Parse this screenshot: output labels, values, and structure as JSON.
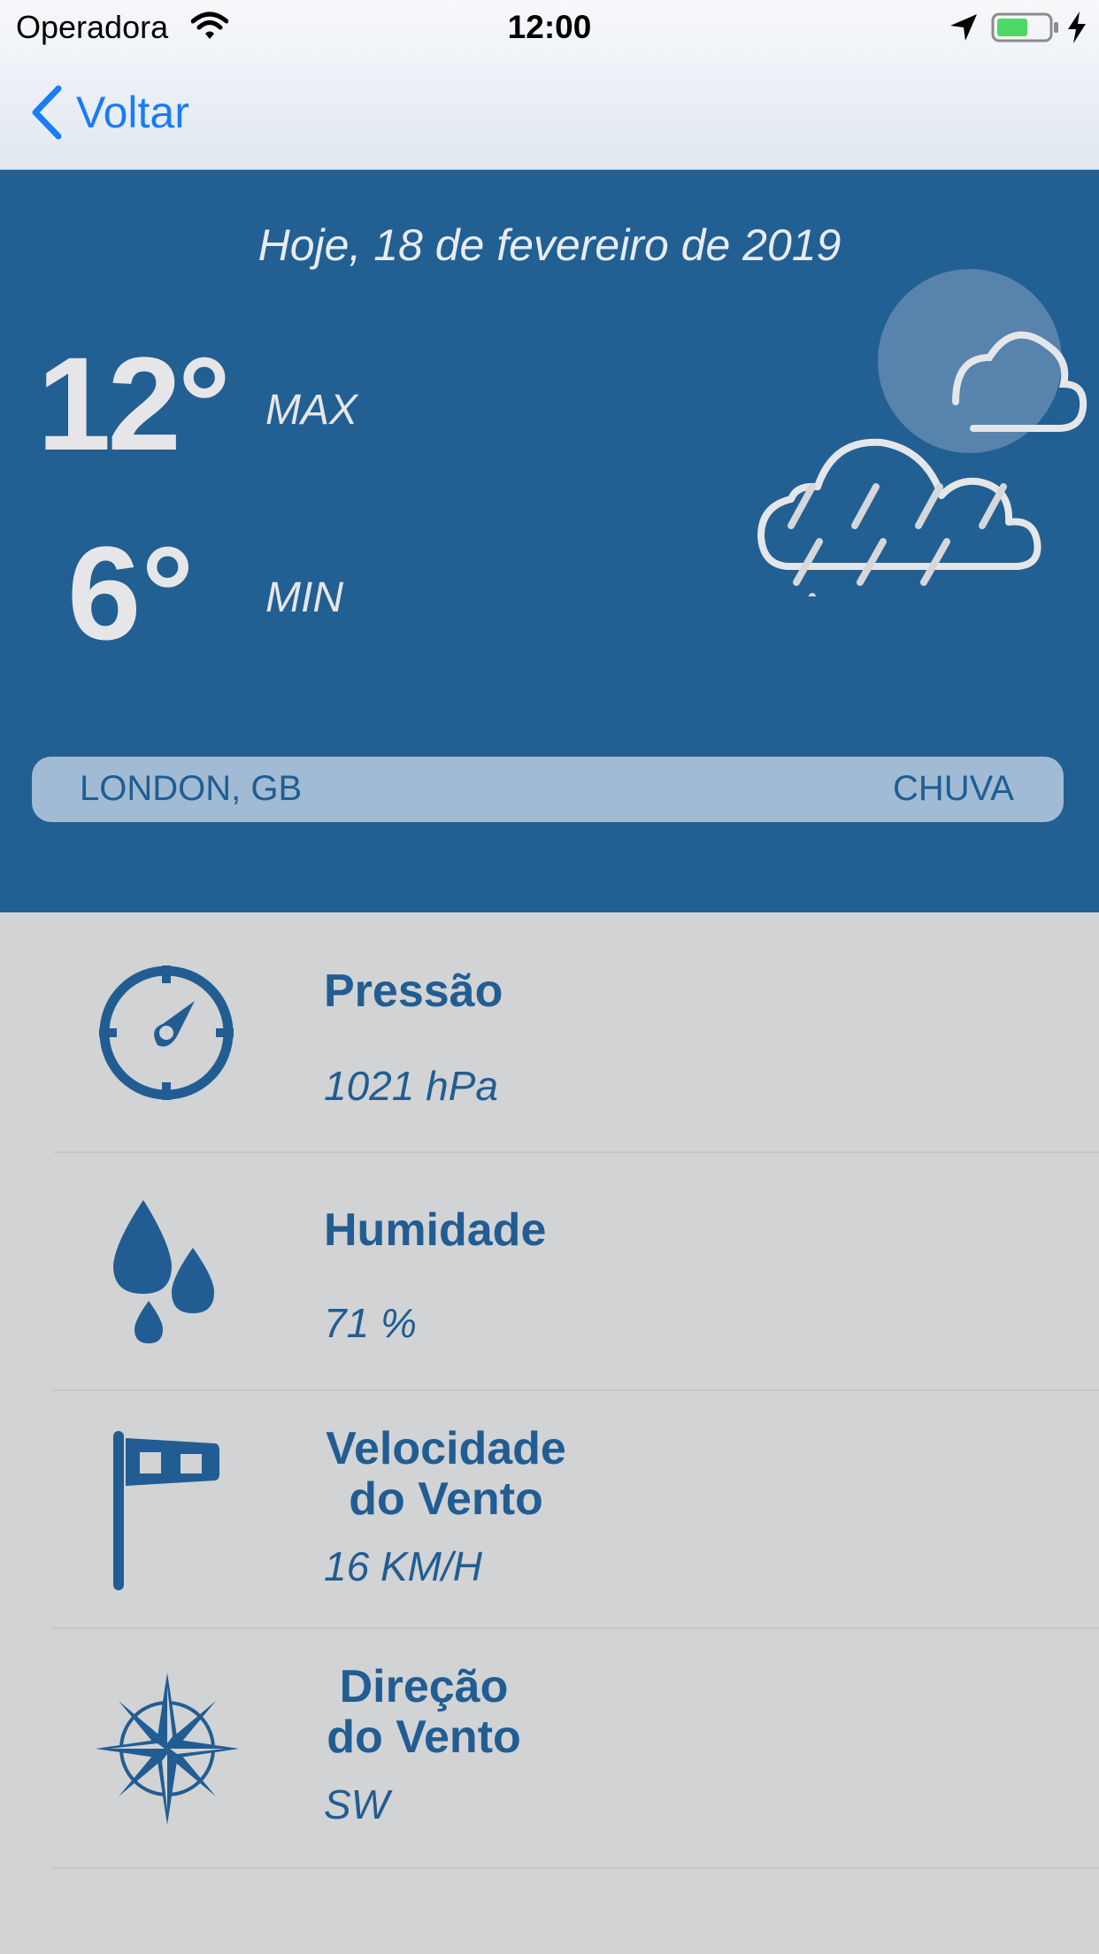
{
  "status_bar": {
    "carrier": "Operadora",
    "time": "12:00"
  },
  "nav": {
    "back_label": "Voltar"
  },
  "hero": {
    "date": "Hoje, 18 de fevereiro de 2019",
    "temp_max": "12°",
    "temp_max_label": "MAX",
    "temp_min": "6°",
    "temp_min_label": "MIN",
    "weather_icon": "rain-cloud-icon",
    "location": "LONDON, GB",
    "condition": "CHUVA"
  },
  "details": [
    {
      "title": "Pressão",
      "value": "1021 hPa",
      "icon": "gauge-icon"
    },
    {
      "title": "Humidade",
      "value": "71 %",
      "icon": "droplets-icon"
    },
    {
      "title_line1": "Velocidade",
      "title_line2": "do Vento",
      "value": "16 KM/H",
      "icon": "windsock-icon"
    },
    {
      "title_line1": "Direção",
      "title_line2": "do Vento",
      "value": "SW",
      "icon": "compass-rose-icon"
    }
  ],
  "colors": {
    "hero_bg": "#225f93",
    "accent_text": "#215d92",
    "link_blue": "#1a7cf6",
    "content_bg": "#d2d3d5"
  }
}
